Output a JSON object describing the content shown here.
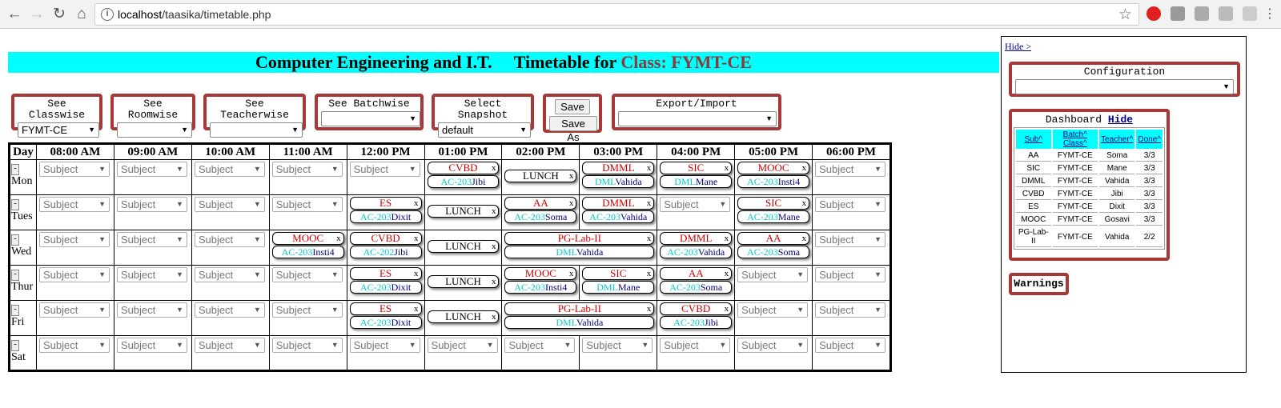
{
  "browser": {
    "url_host": "localhost",
    "url_path": "/taasika/timetable.php"
  },
  "header": {
    "title_main": "Computer Engineering and I.T.     Timetable for ",
    "title_class": "Class: FYMT-CE"
  },
  "controls": {
    "classwise": {
      "label": "See Classwise",
      "value": "FYMT-CE"
    },
    "roomwise": {
      "label": "See Roomwise",
      "value": ""
    },
    "teacherwise": {
      "label": "See Teacherwise",
      "value": ""
    },
    "batchwise": {
      "label": "See Batchwise",
      "value": ""
    },
    "snapshot": {
      "label": "Select Snapshot",
      "value": "default"
    },
    "save_label": "Save",
    "save_as_label": "Save As",
    "export": {
      "label": "Export/Import",
      "value": ""
    }
  },
  "timetable": {
    "day_header": "Day",
    "slots": [
      "08:00 AM",
      "09:00 AM",
      "10:00 AM",
      "11:00 AM",
      "12:00 PM",
      "01:00 PM",
      "02:00 PM",
      "03:00 PM",
      "04:00 PM",
      "05:00 PM",
      "06:00 PM"
    ],
    "empty_placeholder": "Subject",
    "remove_glyph": "x",
    "day_btn": "-",
    "days": [
      {
        "name": "Mon",
        "cells": [
          {
            "t": "empty"
          },
          {
            "t": "empty"
          },
          {
            "t": "empty"
          },
          {
            "t": "empty"
          },
          {
            "t": "empty"
          },
          {
            "t": "class",
            "sub": "CVBD",
            "room": "AC-203",
            "teacher": "Jibi"
          },
          {
            "t": "lunch",
            "text": "LUNCH"
          },
          {
            "t": "class",
            "sub": "DMML",
            "room": "DML",
            "teacher": "Vahida"
          },
          {
            "t": "class",
            "sub": "SIC",
            "room": "DML",
            "teacher": "Mane"
          },
          {
            "t": "class",
            "sub": "MOOC",
            "room": "AC-203",
            "teacher": "Insti4"
          },
          {
            "t": "empty"
          }
        ]
      },
      {
        "name": "Tues",
        "cells": [
          {
            "t": "empty"
          },
          {
            "t": "empty"
          },
          {
            "t": "empty"
          },
          {
            "t": "empty"
          },
          {
            "t": "class",
            "sub": "ES",
            "room": "AC-203",
            "teacher": "Dixit"
          },
          {
            "t": "lunch",
            "text": "LUNCH"
          },
          {
            "t": "class",
            "sub": "AA",
            "room": "AC-203",
            "teacher": "Soma"
          },
          {
            "t": "class",
            "sub": "DMML",
            "room": "AC-203",
            "teacher": "Vahida"
          },
          {
            "t": "empty"
          },
          {
            "t": "class",
            "sub": "SIC",
            "room": "AC-203",
            "teacher": "Mane"
          },
          {
            "t": "empty"
          }
        ]
      },
      {
        "name": "Wed",
        "cells": [
          {
            "t": "empty"
          },
          {
            "t": "empty"
          },
          {
            "t": "empty"
          },
          {
            "t": "class",
            "sub": "MOOC",
            "room": "AC-203",
            "teacher": "Insti4"
          },
          {
            "t": "class",
            "sub": "CVBD",
            "room": "AC-202",
            "teacher": "Jibi"
          },
          {
            "t": "lunch",
            "text": "LUNCH"
          },
          {
            "t": "lab",
            "span": 2,
            "sub": "PG-Lab-II",
            "room": "DML",
            "teacher": "Vahida"
          },
          {
            "t": "class",
            "sub": "DMML",
            "room": "AC-203",
            "teacher": "Vahida"
          },
          {
            "t": "class",
            "sub": "AA",
            "room": "AC-203",
            "teacher": "Soma"
          },
          {
            "t": "empty"
          }
        ]
      },
      {
        "name": "Thur",
        "cells": [
          {
            "t": "empty"
          },
          {
            "t": "empty"
          },
          {
            "t": "empty"
          },
          {
            "t": "empty"
          },
          {
            "t": "class",
            "sub": "ES",
            "room": "AC-203",
            "teacher": "Dixit"
          },
          {
            "t": "lunch",
            "text": "LUNCH"
          },
          {
            "t": "class",
            "sub": "MOOC",
            "room": "AC-203",
            "teacher": "Insti4"
          },
          {
            "t": "class",
            "sub": "SIC",
            "room": "DML",
            "teacher": "Mane"
          },
          {
            "t": "class",
            "sub": "AA",
            "room": "AC-203",
            "teacher": "Soma"
          },
          {
            "t": "empty"
          },
          {
            "t": "empty"
          }
        ]
      },
      {
        "name": "Fri",
        "cells": [
          {
            "t": "empty"
          },
          {
            "t": "empty"
          },
          {
            "t": "empty"
          },
          {
            "t": "empty"
          },
          {
            "t": "class",
            "sub": "ES",
            "room": "AC-203",
            "teacher": "Dixit"
          },
          {
            "t": "lunch",
            "text": "LUNCH"
          },
          {
            "t": "lab",
            "span": 2,
            "sub": "PG-Lab-II",
            "room": "DML",
            "teacher": "Vahida"
          },
          {
            "t": "class",
            "sub": "CVBD",
            "room": "AC-203",
            "teacher": "Jibi"
          },
          {
            "t": "empty"
          },
          {
            "t": "empty"
          }
        ]
      },
      {
        "name": "Sat",
        "cells": [
          {
            "t": "empty"
          },
          {
            "t": "empty"
          },
          {
            "t": "empty"
          },
          {
            "t": "empty"
          },
          {
            "t": "empty"
          },
          {
            "t": "empty"
          },
          {
            "t": "empty"
          },
          {
            "t": "empty"
          },
          {
            "t": "empty"
          },
          {
            "t": "empty"
          },
          {
            "t": "empty"
          }
        ]
      }
    ]
  },
  "panel": {
    "hide_label": "Hide >",
    "configuration_label": "Configuration",
    "configuration_value": "",
    "dashboard_label": "Dashboard",
    "dashboard_hide": "Hide",
    "dashboard_headers": [
      "Sub^",
      "Batch^ Class^",
      "Teacher^",
      "Done^"
    ],
    "dashboard_rows": [
      [
        "AA",
        "FYMT-CE",
        "Soma",
        "3/3"
      ],
      [
        "SIC",
        "FYMT-CE",
        "Mane",
        "3/3"
      ],
      [
        "DMML",
        "FYMT-CE",
        "Vahida",
        "3/3"
      ],
      [
        "CVBD",
        "FYMT-CE",
        "Jibi",
        "3/3"
      ],
      [
        "ES",
        "FYMT-CE",
        "Dixit",
        "3/3"
      ],
      [
        "MOOC",
        "FYMT-CE",
        "Gosavi",
        "3/3"
      ],
      [
        "PG-Lab-II",
        "FYMT-CE",
        "Vahida",
        "2/2"
      ]
    ],
    "warnings_label": "Warnings"
  },
  "colors": {
    "title_bg": "#00ffff",
    "box_border": "#a83838",
    "subject_text": "#d00000",
    "room_text": "#00cccc",
    "teacher_text": "#000080"
  }
}
